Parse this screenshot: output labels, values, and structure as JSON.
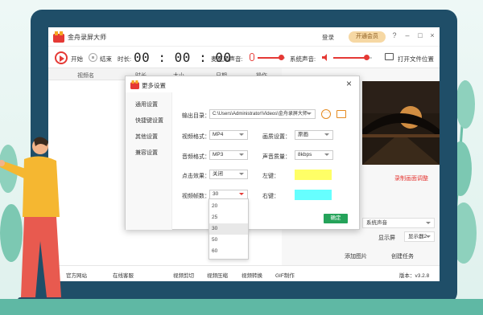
{
  "app": {
    "title": "金舟录屏大师",
    "login": "登录",
    "vip": "开通会员",
    "window_controls": [
      "?",
      "–",
      "□",
      "×"
    ]
  },
  "toolbar": {
    "start_label": "开始",
    "stop_label": "结束",
    "duration_label": "时长:",
    "timer": "00 : 00 : 00",
    "mic_label": "麦克风声音:",
    "mic_level": 0.85,
    "system_sound_label": "系统声音:",
    "system_sound_level": 0.85,
    "open_folder_label": "打开文件位置"
  },
  "file_list": {
    "columns": [
      "视频名",
      "时长",
      "大小",
      "日期",
      "操作"
    ]
  },
  "right_panel": {
    "settings_link": "录制画面调整",
    "audio_select": "系统声音",
    "display_label": "显示屏",
    "display_select": "显示器2",
    "add_image": "添加图片",
    "create_task": "创建任务",
    "more_settings": "更多设置"
  },
  "bottombar": {
    "website": "官方网站",
    "support": "在线客服",
    "tools": [
      "视频剪切",
      "视频压缩",
      "视频转换",
      "GIF制作"
    ],
    "version": "版本：v3.2.8"
  },
  "dialog": {
    "title": "更多设置",
    "close": "×",
    "sidebar": [
      "通用设置",
      "快捷键设置",
      "其他设置",
      "兼容设置"
    ],
    "output_dir_label": "输出目录：",
    "output_dir_value": "C:\\Users\\Administrator\\Videos\\金舟录屏大师",
    "video_format_label": "视频格式：",
    "video_format_value": "MP4",
    "quality_label": "画质设置：",
    "quality_value": "原画",
    "audio_format_label": "音频格式：",
    "audio_format_value": "MP3",
    "audio_quality_label": "声音质量：",
    "audio_quality_value": "8kbps",
    "click_effect_label": "点击效果：",
    "click_effect_value": "关闭",
    "left_key_label": "左键：",
    "left_key_color": "#ffff66",
    "fps_label": "视频帧数：",
    "fps_value": "30",
    "right_key_label": "右键：",
    "right_key_color": "#66ffff",
    "ok_label": "确定",
    "fps_options": [
      "20",
      "25",
      "30",
      "50",
      "60"
    ],
    "fps_selected_index": 2
  }
}
